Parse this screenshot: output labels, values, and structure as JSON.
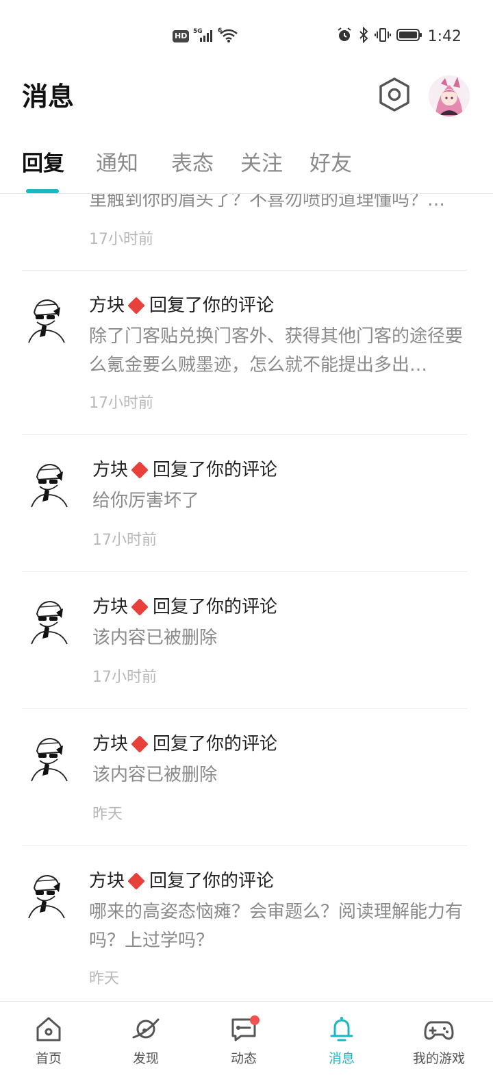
{
  "status_bar": {
    "network_badge": "HD",
    "signal": "5G",
    "wifi": "6",
    "time": "1:42"
  },
  "header": {
    "title": "消息",
    "settings_icon": "hexagon-gear-icon",
    "avatar_icon": "user-avatar"
  },
  "tabs": [
    {
      "label": "回复",
      "active": true
    },
    {
      "label": "通知",
      "active": false
    },
    {
      "label": "表态",
      "active": false
    },
    {
      "label": "关注",
      "active": false
    },
    {
      "label": "好友",
      "active": false
    }
  ],
  "partial_item": {
    "content": "里触到你的眉头了？不喜勿喷的道理懂吗？…",
    "time": "17小时前"
  },
  "messages": [
    {
      "user": "方块",
      "action": "回复了你的评论",
      "content": "除了门客贴兑换门客外、获得其他门客的途径要么氪金要么贼墨迹，怎么就不能提出多出…",
      "time": "17小时前"
    },
    {
      "user": "方块",
      "action": "回复了你的评论",
      "content": "给你厉害坏了",
      "time": "17小时前"
    },
    {
      "user": "方块",
      "action": "回复了你的评论",
      "content": "该内容已被删除",
      "time": "17小时前"
    },
    {
      "user": "方块",
      "action": "回复了你的评论",
      "content": "该内容已被删除",
      "time": "昨天"
    },
    {
      "user": "方块",
      "action": "回复了你的评论",
      "content": "哪来的高姿态恼瘫？会审题么？阅读理解能力有吗？上过学吗？",
      "time": "昨天"
    }
  ],
  "bottom_nav": [
    {
      "label": "首页",
      "icon": "home-icon",
      "active": false
    },
    {
      "label": "发现",
      "icon": "planet-icon",
      "active": false
    },
    {
      "label": "动态",
      "icon": "chat-icon",
      "active": false,
      "badge": true
    },
    {
      "label": "消息",
      "icon": "bell-icon",
      "active": true
    },
    {
      "label": "我的游戏",
      "icon": "gamepad-icon",
      "active": false
    }
  ],
  "colors": {
    "accent": "#19b7c3",
    "badge": "#f25151",
    "diamond": "#e8413b"
  }
}
